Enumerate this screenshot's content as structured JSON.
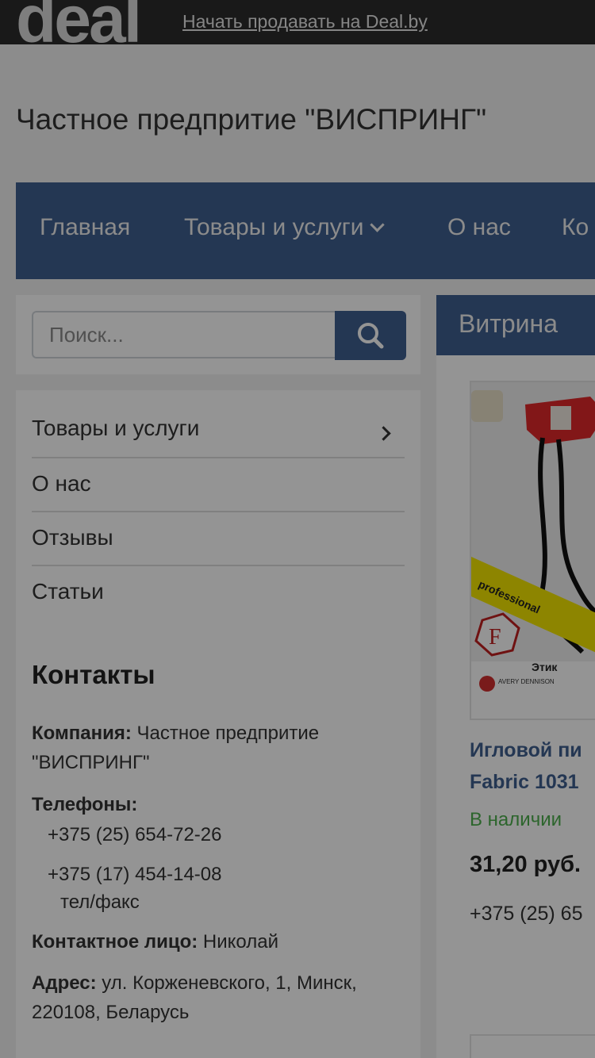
{
  "topbar": {
    "logo_text": "deal",
    "sell_link": "Начать продавать на Deal.by"
  },
  "company": {
    "title": "Частное предпритие \"ВИСПРИНГ\""
  },
  "nav": {
    "items": [
      {
        "label": "Главная"
      },
      {
        "label": "Товары и услуги"
      },
      {
        "label": "О нас"
      },
      {
        "label": "Ко"
      }
    ]
  },
  "search": {
    "placeholder": "Поиск..."
  },
  "side_menu": {
    "items": [
      {
        "label": "Товары и услуги"
      },
      {
        "label": "О нас"
      },
      {
        "label": "Отзывы"
      },
      {
        "label": "Статьи"
      }
    ]
  },
  "contacts": {
    "title": "Контакты",
    "company_label": "Компания:",
    "company_value_1": "Частное предпритие",
    "company_value_2": "\"ВИСПРИНГ\"",
    "phones_label": "Телефоны:",
    "phone_1": "+375 (25) 654-72-26",
    "phone_2": "+375 (17) 454-14-08",
    "phone_2_note": "тел/факс",
    "contact_person_label": "Контактное лицо:",
    "contact_person_value": "Николай",
    "address_label": "Адрес:",
    "address_line_1": "ул. Корженевского, 1, Минск,",
    "address_line_2": "220108, Беларусь"
  },
  "showcase": {
    "title": "Витрина",
    "product": {
      "name_line_1": "Игловой пи",
      "name_line_2": "Fabric 1031",
      "availability": "В наличии",
      "price": "31,20 руб.",
      "phone": "+375 (25) 65",
      "image_text_1": "professional",
      "image_text_2": "F",
      "image_text_3": "Этик",
      "image_brand": "AVERY DENNISON"
    }
  },
  "colors": {
    "brand_blue": "#3f5f8f",
    "in_stock_green": "#4cae4c",
    "topbar_bg": "#2b2b2b"
  }
}
